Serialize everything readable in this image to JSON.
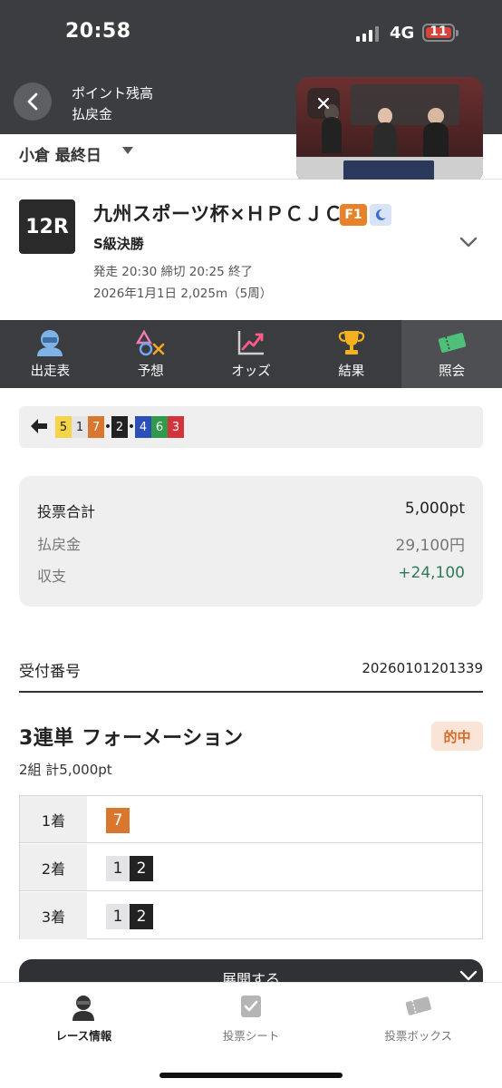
{
  "status_bar": {
    "time": "20:58",
    "network": "4G",
    "battery": "11"
  },
  "header": {
    "line1": "ポイント残高",
    "line2": "払戻金"
  },
  "venue": {
    "label": "小倉 最終日"
  },
  "race": {
    "number": "12R",
    "title": "九州スポーツ杯×ＨＰＣＪＣ",
    "grade": "F1",
    "class": "S級決勝",
    "meta1": "発走 20:30 締切 20:25  終了",
    "meta2": "2026年1月1日 2,025m（5周）"
  },
  "tabs": [
    {
      "label": "出走表",
      "icon": "rider-icon"
    },
    {
      "label": "予想",
      "icon": "prediction-icon"
    },
    {
      "label": "オッズ",
      "icon": "odds-chart-icon"
    },
    {
      "label": "結果",
      "icon": "trophy-icon"
    },
    {
      "label": "照会",
      "icon": "ticket-icon",
      "active": true
    }
  ],
  "line_formation": {
    "chips": [
      {
        "text": "5",
        "bg": "#f5d547",
        "fg": "#222"
      },
      {
        "text": "1",
        "bg": "#e4e4e6",
        "fg": "#222"
      },
      {
        "text": "7",
        "bg": "#d9772f",
        "fg": "#fff"
      },
      {
        "text": "•",
        "sep": true
      },
      {
        "text": "2",
        "bg": "#222222",
        "fg": "#fff"
      },
      {
        "text": "•",
        "sep": true
      },
      {
        "text": "4",
        "bg": "#2a4fb8",
        "fg": "#fff"
      },
      {
        "text": "6",
        "bg": "#2f9a4a",
        "fg": "#fff"
      },
      {
        "text": "3",
        "bg": "#d3333a",
        "fg": "#fff"
      }
    ]
  },
  "summary": {
    "total_label": "投票合計",
    "total_value": "5,000pt",
    "payout_label": "払戻金",
    "payout_value": "29,100円",
    "balance_label": "収支",
    "balance_value": "+24,100",
    "balance_color": "#2f7a5b"
  },
  "receipt": {
    "label": "受付番号",
    "number": "20260101201339"
  },
  "bet": {
    "type": "3連単 フォーメーション",
    "result_badge": "的中",
    "detail": "2組 計5,000pt",
    "rows": [
      {
        "label": "1着",
        "numbers": [
          {
            "n": "7",
            "bg": "#d9772f",
            "fg": "#fff"
          }
        ]
      },
      {
        "label": "2着",
        "numbers": [
          {
            "n": "1",
            "bg": "#e4e4e6",
            "fg": "#222"
          },
          {
            "n": "2",
            "bg": "#222222",
            "fg": "#fff"
          }
        ]
      },
      {
        "label": "3着",
        "numbers": [
          {
            "n": "1",
            "bg": "#e4e4e6",
            "fg": "#222"
          },
          {
            "n": "2",
            "bg": "#222222",
            "fg": "#fff"
          }
        ]
      }
    ]
  },
  "expand": {
    "label": "展開する"
  },
  "bottom_nav": [
    {
      "label": "レース情報",
      "icon": "race-info-icon",
      "active": true
    },
    {
      "label": "投票シート",
      "icon": "vote-sheet-icon"
    },
    {
      "label": "投票ボックス",
      "icon": "vote-box-icon"
    }
  ]
}
